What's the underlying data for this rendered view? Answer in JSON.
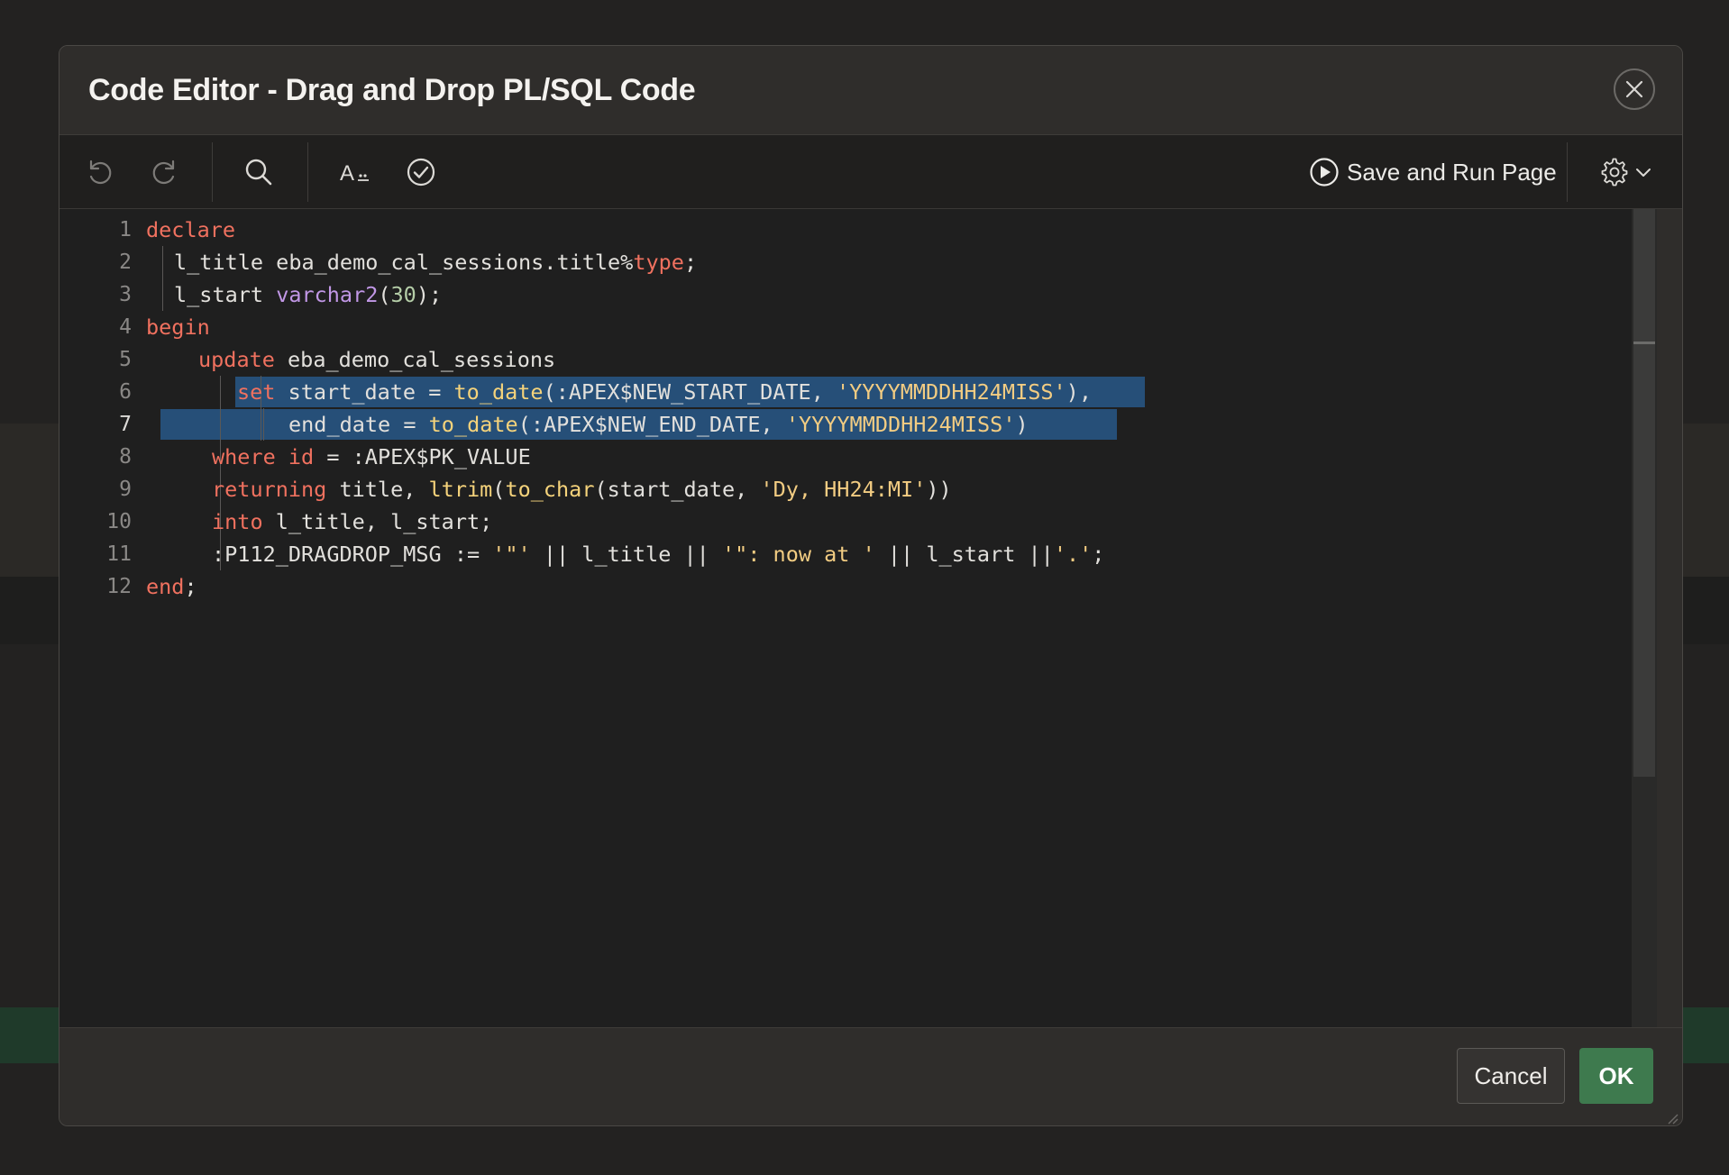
{
  "dialog": {
    "title": "Code Editor - Drag and Drop PL/SQL Code"
  },
  "toolbar": {
    "undo_icon": "undo-icon",
    "redo_icon": "redo-icon",
    "search_icon": "search-icon",
    "font_icon": "font-size-icon",
    "validate_icon": "validate-check-icon",
    "save_run_label": "Save and Run Page",
    "settings_icon": "gear-icon"
  },
  "editor": {
    "active_line": 7,
    "line_numbers": [
      "1",
      "2",
      "3",
      "4",
      "5",
      "6",
      "7",
      "8",
      "9",
      "10",
      "11",
      "12"
    ],
    "lines": [
      [
        {
          "t": "declare",
          "c": "kw"
        }
      ],
      [
        {
          "t": "l_title eba_demo_cal_sessions.title%",
          "c": ""
        },
        {
          "t": "type",
          "c": "kw"
        },
        {
          "t": ";",
          "c": ""
        }
      ],
      [
        {
          "t": "l_start ",
          "c": ""
        },
        {
          "t": "varchar2",
          "c": "typ"
        },
        {
          "t": "(",
          "c": ""
        },
        {
          "t": "30",
          "c": "num"
        },
        {
          "t": ");",
          "c": ""
        }
      ],
      [
        {
          "t": "begin",
          "c": "kw"
        }
      ],
      [
        {
          "t": "update",
          "c": "kw"
        },
        {
          "t": " eba_demo_cal_sessions",
          "c": ""
        }
      ],
      [
        {
          "t": "set",
          "c": "kw"
        },
        {
          "t": " start_date = ",
          "c": ""
        },
        {
          "t": "to_date",
          "c": "fn"
        },
        {
          "t": "(:APEX$NEW_START_DATE, ",
          "c": ""
        },
        {
          "t": "'YYYYMMDDHH24MISS'",
          "c": "str"
        },
        {
          "t": "),",
          "c": ""
        }
      ],
      [
        {
          "t": "end_date = ",
          "c": ""
        },
        {
          "t": "to_date",
          "c": "fn"
        },
        {
          "t": "(:APEX$NEW_END_DATE, ",
          "c": ""
        },
        {
          "t": "'YYYYMMDDHH24MISS'",
          "c": "str"
        },
        {
          "t": ")",
          "c": ""
        }
      ],
      [
        {
          "t": "where",
          "c": "kw"
        },
        {
          "t": " ",
          "c": ""
        },
        {
          "t": "id",
          "c": "kw"
        },
        {
          "t": " = :APEX$PK_VALUE",
          "c": ""
        }
      ],
      [
        {
          "t": "returning",
          "c": "kw"
        },
        {
          "t": " title, ",
          "c": ""
        },
        {
          "t": "ltrim",
          "c": "fn"
        },
        {
          "t": "(",
          "c": ""
        },
        {
          "t": "to_char",
          "c": "fn"
        },
        {
          "t": "(start_date, ",
          "c": ""
        },
        {
          "t": "'Dy, HH24:MI'",
          "c": "str"
        },
        {
          "t": "))",
          "c": ""
        }
      ],
      [
        {
          "t": "into",
          "c": "kw"
        },
        {
          "t": " l_title, l_start;",
          "c": ""
        }
      ],
      [
        {
          "t": ":P112_DRAGDROP_MSG := ",
          "c": ""
        },
        {
          "t": "'\"'",
          "c": "str"
        },
        {
          "t": " || l_title || ",
          "c": ""
        },
        {
          "t": "'\": now at '",
          "c": "str"
        },
        {
          "t": " || l_start ||",
          "c": ""
        },
        {
          "t": "'.'",
          "c": "str"
        },
        {
          "t": ";",
          "c": ""
        }
      ],
      [
        {
          "t": "end",
          "c": "kw"
        },
        {
          "t": ";",
          "c": ""
        }
      ]
    ]
  },
  "footer": {
    "cancel_label": "Cancel",
    "ok_label": "OK"
  },
  "colors": {
    "keyword": "#f0715f",
    "function": "#f5d37b",
    "string": "#f2cc82",
    "type": "#c197e6",
    "number": "#b5cea8",
    "selection": "#264f78",
    "ok_button": "#3e7a4e"
  }
}
